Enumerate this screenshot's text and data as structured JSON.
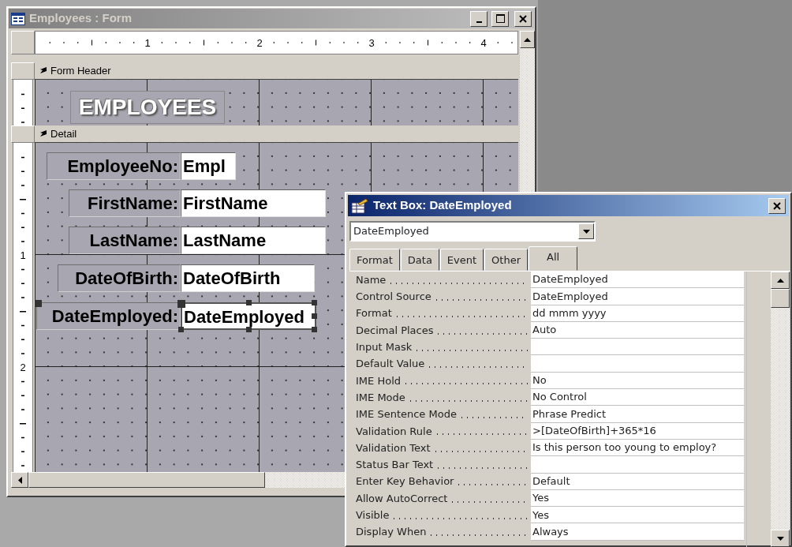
{
  "form_window": {
    "title": "Employees : Form",
    "ruler_labels": [
      "1",
      "2",
      "3",
      "4"
    ],
    "vertical_ruler_labels": [
      "1",
      "2"
    ],
    "sections": [
      {
        "label": "Form Header"
      },
      {
        "label": "Detail"
      }
    ],
    "header_label": "EMPLOYEES",
    "controls": [
      {
        "label": "EmployeeNo:",
        "field": "Empl",
        "selected": false
      },
      {
        "label": "FirstName:",
        "field": "FirstName",
        "selected": false
      },
      {
        "label": "LastName:",
        "field": "LastName",
        "selected": false
      },
      {
        "label": "DateOfBirth:",
        "field": "DateOfBirth",
        "selected": false
      },
      {
        "label": "DateEmployed:",
        "field": "DateEmployed",
        "selected": true
      }
    ]
  },
  "property_sheet": {
    "title": "Text Box: DateEmployed",
    "object_select": "DateEmployed",
    "tabs": [
      {
        "label": "Format",
        "selected": false
      },
      {
        "label": "Data",
        "selected": false
      },
      {
        "label": "Event",
        "selected": false
      },
      {
        "label": "Other",
        "selected": false
      },
      {
        "label": "All",
        "selected": true
      }
    ],
    "properties": [
      {
        "name": "Name",
        "value": "DateEmployed"
      },
      {
        "name": "Control Source",
        "value": "DateEmployed"
      },
      {
        "name": "Format",
        "value": "dd mmm yyyy"
      },
      {
        "name": "Decimal Places",
        "value": "Auto"
      },
      {
        "name": "Input Mask"
      },
      {
        "name": "Default Value"
      },
      {
        "name": "IME Hold",
        "value": "No"
      },
      {
        "name": "IME Mode",
        "value": "No Control"
      },
      {
        "name": "IME Sentence Mode",
        "value": "Phrase Predict"
      },
      {
        "name": "Validation Rule",
        "value": ">[DateOfBirth]+365*16"
      },
      {
        "name": "Validation Text",
        "value": "Is this person too young to employ?"
      },
      {
        "name": "Status Bar Text"
      },
      {
        "name": "Enter Key Behavior",
        "value": "Default"
      },
      {
        "name": "Allow AutoCorrect",
        "value": "Yes"
      },
      {
        "name": "Visible",
        "value": "Yes"
      },
      {
        "name": "Display When",
        "value": "Always"
      }
    ]
  }
}
